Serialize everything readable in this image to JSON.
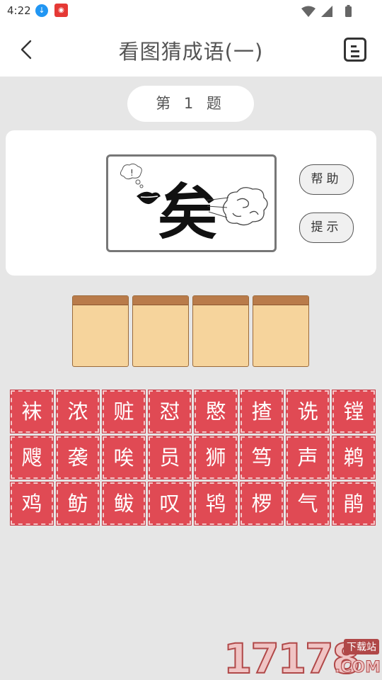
{
  "status_bar": {
    "time": "4:22",
    "icons": [
      "download-app-icon",
      "red-app-icon",
      "wifi-icon",
      "signal-icon",
      "battery-icon"
    ]
  },
  "app_bar": {
    "title": "看图猜成语(一)",
    "back_icon": "chevron-left-icon",
    "menu_icon": "note-list-icon"
  },
  "question": {
    "label": "第 1 题"
  },
  "puzzle": {
    "image": "lips-thought-bubble-character-wind-cloud",
    "image_character": "矣",
    "help_label": "帮助",
    "hint_label": "提示"
  },
  "answer_slots": [
    "",
    "",
    "",
    ""
  ],
  "characters": [
    [
      "袜",
      "浓",
      "赃",
      "怼",
      "愍",
      "揸",
      "诜",
      "镗"
    ],
    [
      "飕",
      "袭",
      "唉",
      "员",
      "狮",
      "笃",
      "声",
      "鹈"
    ],
    [
      "鸡",
      "鲂",
      "鲅",
      "叹",
      "鸨",
      "椤",
      "气",
      "鹃"
    ]
  ],
  "watermark": {
    "number": "17178",
    "tag": "下载站",
    "domain": ".COM"
  },
  "colors": {
    "tile_red": "#e04a54",
    "slot_fill": "#f6d49c",
    "slot_cap": "#b97b4a",
    "background": "#e6e6e6"
  }
}
